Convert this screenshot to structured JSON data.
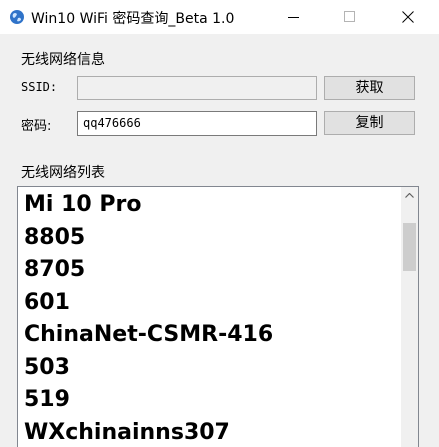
{
  "window": {
    "title": "Win10 WiFi 密码查询_Beta 1.0",
    "icon": "app-globe-icon",
    "controls": [
      "minimize-icon",
      "maximize-icon",
      "close-icon"
    ]
  },
  "info_group": {
    "title": "无线网络信息",
    "ssid_label": "SSID:",
    "ssid_value": "",
    "get_button": "获取",
    "password_label": "密码:",
    "password_value": "qq476666",
    "copy_button": "复制"
  },
  "list_group": {
    "title": "无线网络列表",
    "items": [
      "Mi 10 Pro",
      "8805",
      "8705",
      "601",
      "ChinaNet-CSMR-416",
      "503",
      "519",
      "WXchinainns307"
    ]
  }
}
